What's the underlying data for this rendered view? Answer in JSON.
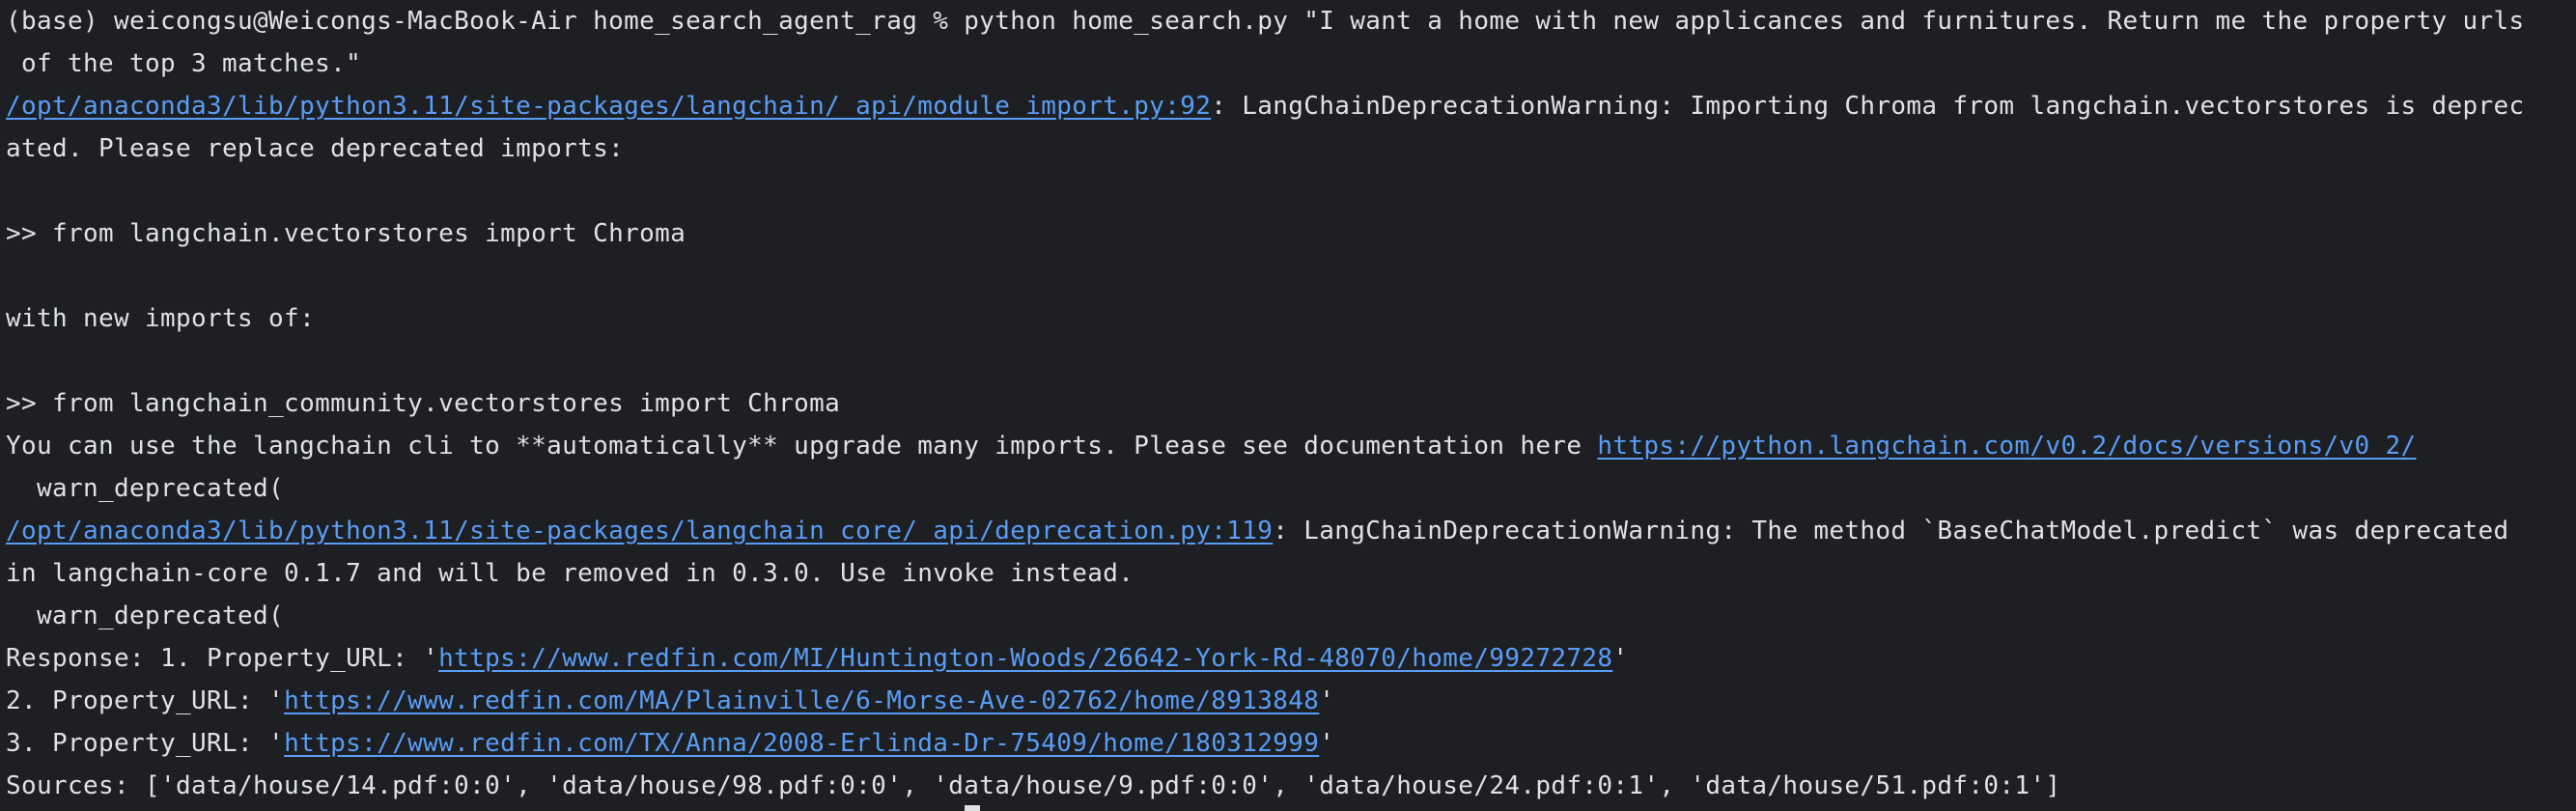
{
  "terminal": {
    "colors": {
      "background": "#1e1f22",
      "text": "#dfe1e5",
      "link": "#589df6"
    },
    "lines": [
      {
        "segments": [
          {
            "text": "(base) weicongsu@Weicongs-MacBook-Air home_search_agent_rag % python home_search.py \"I want a home with new applicances and furnitures. Return me the property urls"
          }
        ]
      },
      {
        "segments": [
          {
            "text": " of the top 3 matches.\""
          }
        ]
      },
      {
        "segments": [
          {
            "text": "/opt/anaconda3/lib/python3.11/site-packages/langchain/_api/module_import.py:92",
            "link": true
          },
          {
            "text": ": LangChainDeprecationWarning: Importing Chroma from langchain.vectorstores is deprec"
          }
        ]
      },
      {
        "segments": [
          {
            "text": "ated. Please replace deprecated imports:"
          }
        ]
      },
      {
        "segments": [
          {
            "text": ""
          }
        ]
      },
      {
        "segments": [
          {
            "text": ">> from langchain.vectorstores import Chroma"
          }
        ]
      },
      {
        "segments": [
          {
            "text": ""
          }
        ]
      },
      {
        "segments": [
          {
            "text": "with new imports of:"
          }
        ]
      },
      {
        "segments": [
          {
            "text": ""
          }
        ]
      },
      {
        "segments": [
          {
            "text": ">> from langchain_community.vectorstores import Chroma"
          }
        ]
      },
      {
        "segments": [
          {
            "text": "You can use the langchain cli to **automatically** upgrade many imports. Please see documentation here "
          },
          {
            "text": "https://python.langchain.com/v0.2/docs/versions/v0_2/",
            "link": true
          }
        ]
      },
      {
        "segments": [
          {
            "text": "  warn_deprecated("
          }
        ]
      },
      {
        "segments": [
          {
            "text": "/opt/anaconda3/lib/python3.11/site-packages/langchain_core/_api/deprecation.py:119",
            "link": true
          },
          {
            "text": ": LangChainDeprecationWarning: The method `BaseChatModel.predict` was deprecated"
          }
        ]
      },
      {
        "segments": [
          {
            "text": "in langchain-core 0.1.7 and will be removed in 0.3.0. Use invoke instead."
          }
        ]
      },
      {
        "segments": [
          {
            "text": "  warn_deprecated("
          }
        ]
      },
      {
        "segments": [
          {
            "text": "Response: 1. Property_URL: '"
          },
          {
            "text": "https://www.redfin.com/MI/Huntington-Woods/26642-York-Rd-48070/home/99272728",
            "link": true
          },
          {
            "text": "'"
          }
        ]
      },
      {
        "segments": [
          {
            "text": "2. Property_URL: '"
          },
          {
            "text": "https://www.redfin.com/MA/Plainville/6-Morse-Ave-02762/home/8913848",
            "link": true
          },
          {
            "text": "'"
          }
        ]
      },
      {
        "segments": [
          {
            "text": "3. Property_URL: '"
          },
          {
            "text": "https://www.redfin.com/TX/Anna/2008-Erlinda-Dr-75409/home/180312999",
            "link": true
          },
          {
            "text": "'"
          }
        ]
      },
      {
        "segments": [
          {
            "text": "Sources: ['data/house/14.pdf:0:0', 'data/house/98.pdf:0:0', 'data/house/9.pdf:0:0', 'data/house/24.pdf:0:1', 'data/house/51.pdf:0:1']"
          }
        ]
      }
    ]
  }
}
